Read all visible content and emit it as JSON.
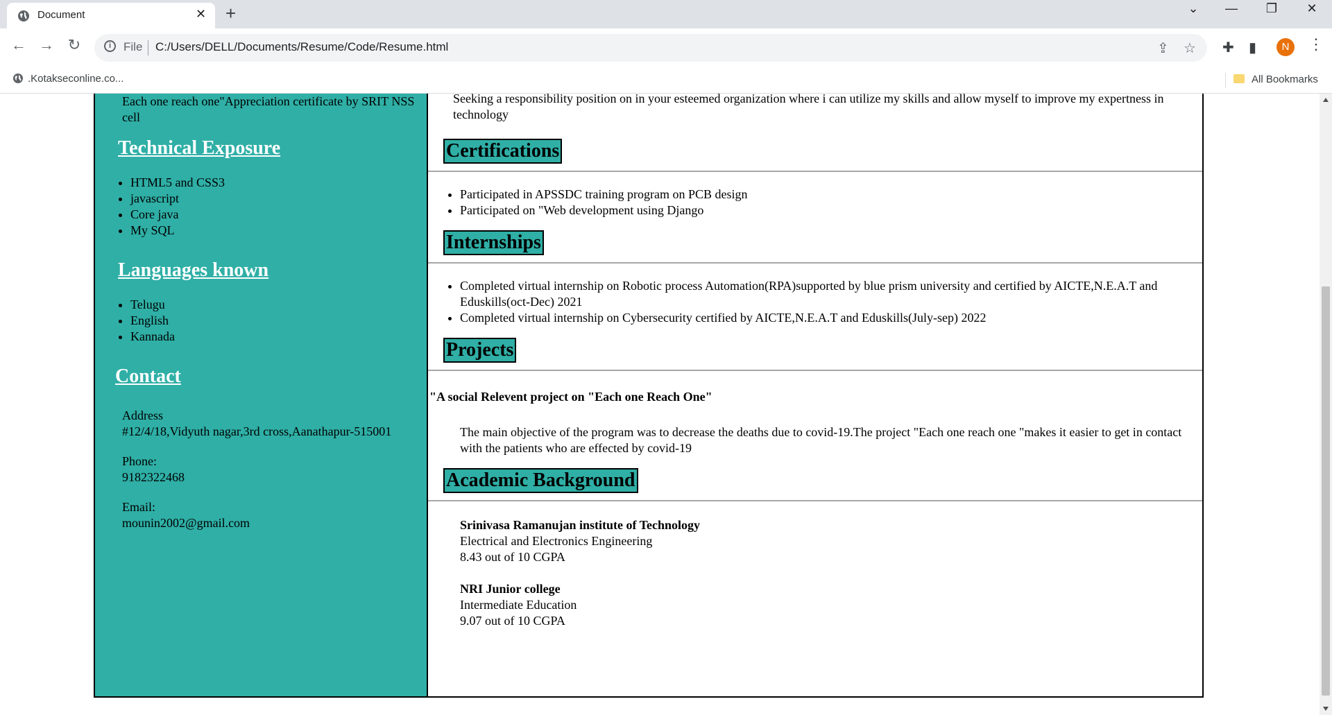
{
  "browser": {
    "tab_title": "Document",
    "omnibox_prefix": "File",
    "url": "C:/Users/DELL/Documents/Resume/Code/Resume.html",
    "profile_initial": "N",
    "bookmark_item": ".Kotakseconline.co...",
    "all_bookmarks": "All Bookmarks"
  },
  "sidebar": {
    "certificate_text": "Each one reach one\"Appreciation certificate by SRIT NSS cell",
    "technical_heading": "Technical Exposure",
    "technical_items": [
      "HTML5 and CSS3",
      "javascript",
      "Core java",
      "My SQL"
    ],
    "languages_heading": "Languages known",
    "languages_items": [
      "Telugu",
      "English",
      "Kannada"
    ],
    "contact_heading": "Contact",
    "address_label": "Address",
    "address_value": "#12/4/18,Vidyuth nagar,3rd cross,Aanathapur-515001",
    "phone_label": "Phone:",
    "phone_value": "9182322468",
    "email_label": "Email:",
    "email_value": "mounin2002@gmail.com"
  },
  "main": {
    "objective": "Seeking a responsibility position on in your esteemed organization where i can utilize my skills and allow myself to improve my expertness in technology",
    "certifications_heading": "Certifications",
    "certifications": [
      "Participated in APSSDC training program on PCB design",
      "Participated on \"Web development using Django"
    ],
    "internships_heading": "Internships",
    "internships": [
      "Completed virtual internship on Robotic process Automation(RPA)supported by blue prism university and certified by AICTE,N.E.A.T and Eduskills(oct-Dec) 2021",
      "Completed virtual internship on Cybersecurity certified by AICTE,N.E.A.T and Eduskills(July-sep) 2022"
    ],
    "projects_heading": "Projects",
    "project_title": "\"A social Relevent project on \"Each one Reach One\"",
    "project_desc": "The main objective of the program was to decrease the deaths due to covid-19.The project \"Each one reach one \"makes it easier to get in contact with the patients who are effected by covid-19",
    "academic_heading": "Academic Background",
    "edu1_name": "Srinivasa Ramanujan institute of Technology",
    "edu1_course": "Electrical and Electronics Engineering",
    "edu1_score": "8.43 out of 10 CGPA",
    "edu2_name": "NRI Junior college",
    "edu2_course": "Intermediate Education",
    "edu2_score": "9.07 out of 10 CGPA"
  }
}
